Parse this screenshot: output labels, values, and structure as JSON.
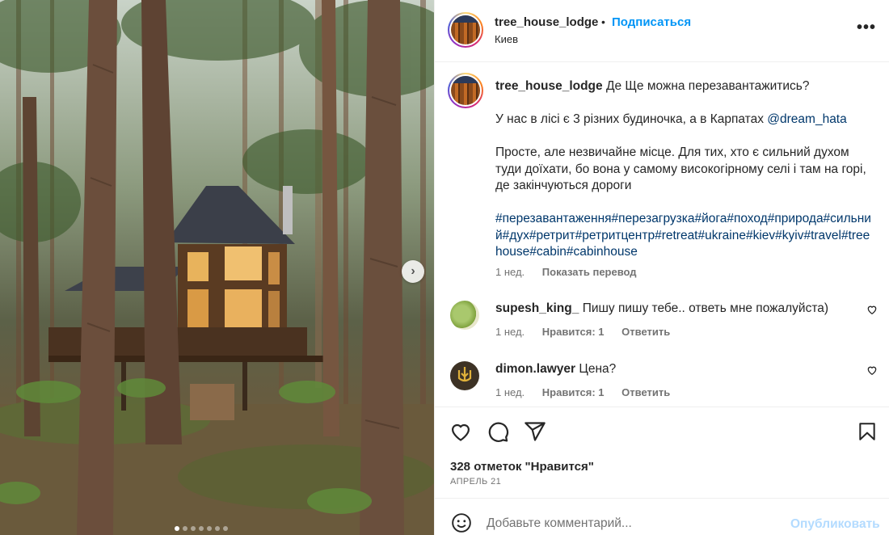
{
  "post": {
    "username": "tree_house_lodge",
    "bullet": "•",
    "follow_label": "Подписаться",
    "location": "Киев",
    "more_label": "•••"
  },
  "caption": {
    "username": "tree_house_lodge",
    "line1": "Де Ще можна перезавантажитись?",
    "para2_text": "У нас в лісі є 3 різних будиночка, а в Карпатах",
    "para2_mention": "@dream_hata",
    "para3": "Просте, але незвичайне місце. Для тих, хто є сильний духом туди доїхати, бо вона у самому високогірному селі і там на горі, де закінчуються дороги",
    "hashtags": "#перезавантаження#перезагрузка#йога#поход#природа#сильний#дух#ретрит#ретритцентр#retreat#ukraine#kiev#kyiv#travel#treehouse#cabin#cabinhouse",
    "time": "1 нед.",
    "translate_label": "Показать перевод"
  },
  "comments": [
    {
      "username": "supesh_king_",
      "text": "Пишу пишу тебе.. ответь мне пожалуйста)",
      "time": "1 нед.",
      "likes": "Нравится: 1",
      "reply": "Ответить"
    },
    {
      "username": "dimon.lawyer",
      "text": "Цена?",
      "time": "1 нед.",
      "likes": "Нравится: 1",
      "reply": "Ответить"
    }
  ],
  "stats": {
    "likes": "328 отметок \"Нравится\"",
    "date": "АПРЕЛЬ 21"
  },
  "add_comment": {
    "placeholder": "Добавьте комментарий...",
    "publish_label": "Опубликовать"
  },
  "carousel": {
    "next_label": "›",
    "slide_count": 7,
    "active_index": 0
  },
  "colors": {
    "accent": "#0095f6",
    "link": "#00376b",
    "muted": "#737373",
    "publish_disabled": "#b3dbff"
  }
}
